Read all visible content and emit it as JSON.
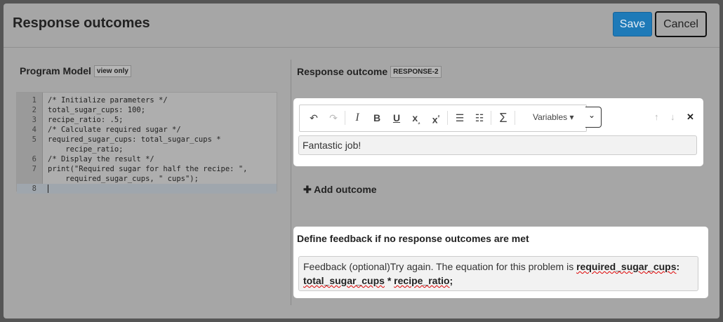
{
  "dialog": {
    "title": "Response outcomes",
    "save_label": "Save",
    "cancel_label": "Cancel"
  },
  "program_model": {
    "heading": "Program Model",
    "tag": "view only",
    "lines": [
      {
        "n": "1",
        "t": "/* Initialize parameters */"
      },
      {
        "n": "2",
        "t": "total_sugar_cups: 100;"
      },
      {
        "n": "3",
        "t": "recipe_ratio: .5;"
      },
      {
        "n": "4",
        "t": "/* Calculate required sugar */"
      },
      {
        "n": "5",
        "t": "required_sugar_cups: total_sugar_cups *"
      },
      {
        "n": "",
        "t": "    recipe_ratio;"
      },
      {
        "n": "6",
        "t": "/* Display the result */"
      },
      {
        "n": "7",
        "t": "print(\"Required sugar for half the recipe: \","
      },
      {
        "n": "",
        "t": "    required_sugar_cups, \" cups\");"
      },
      {
        "n": "8",
        "t": ""
      }
    ]
  },
  "response_outcome": {
    "heading": "Response outcome",
    "tag": "RESPONSE-2",
    "toolbar": {
      "variables_label": "Variables ▾"
    },
    "feedback_value": "Fantastic job!",
    "add_outcome_label": "Add outcome"
  },
  "no_match": {
    "heading": "Define feedback if no response outcomes are met",
    "prefix": "Feedback (optional)Try again. The equation for this problem is ",
    "eq_part1": "required_sugar_cups",
    "eq_part2": ":",
    "eq_part3": "total_sugar_cups",
    "eq_part4": " * ",
    "eq_part5": "recipe_ratio",
    "eq_part6": ";"
  },
  "colors": {
    "save_button": "#1e7ab8",
    "overlay": "#a6a6a6"
  }
}
